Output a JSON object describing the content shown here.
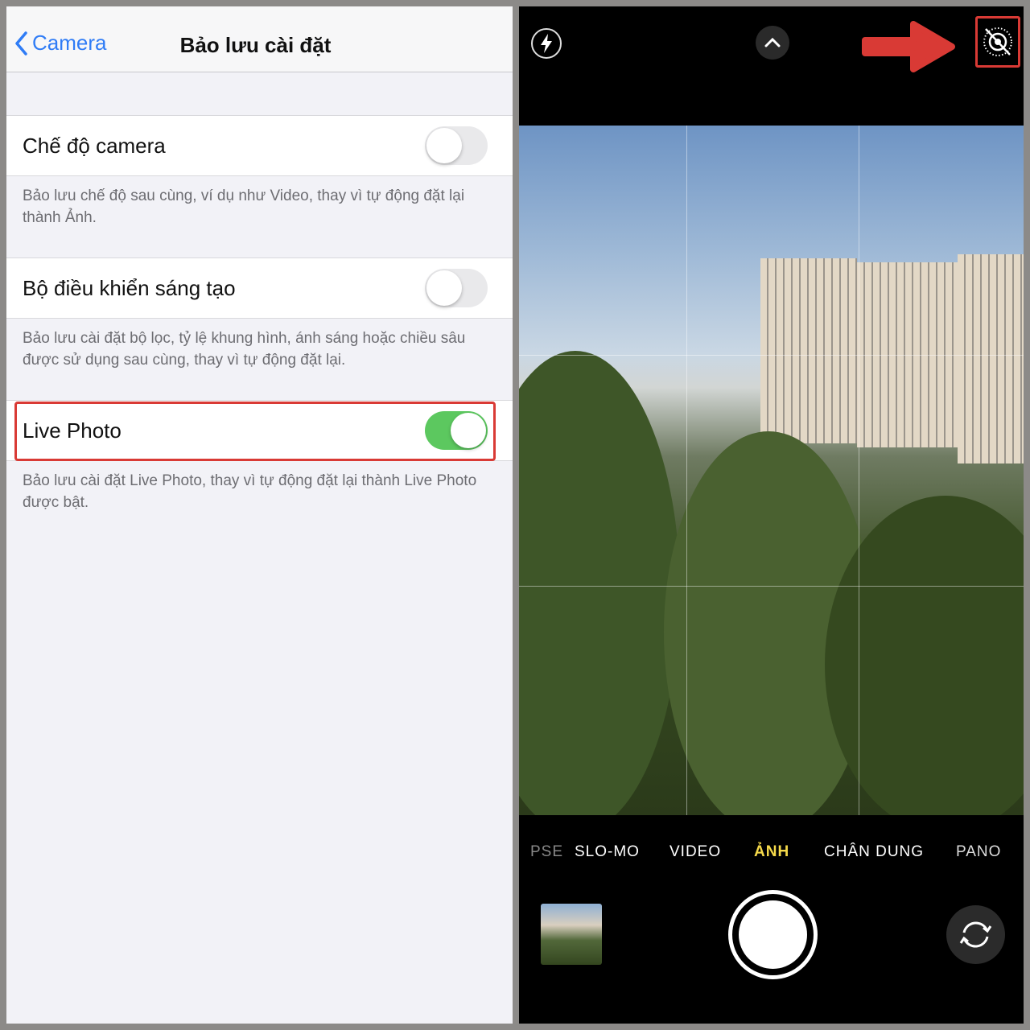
{
  "settings": {
    "back_label": "Camera",
    "title": "Bảo lưu cài đặt",
    "rows": [
      {
        "label": "Chế độ camera",
        "on": false,
        "desc": "Bảo lưu chế độ sau cùng, ví dụ như Video, thay vì tự động đặt lại thành Ảnh."
      },
      {
        "label": "Bộ điều khiển sáng tạo",
        "on": false,
        "desc": "Bảo lưu cài đặt bộ lọc, tỷ lệ khung hình, ánh sáng hoặc chiều sâu được sử dụng sau cùng, thay vì tự động đặt lại."
      },
      {
        "label": "Live Photo",
        "on": true,
        "desc": "Bảo lưu cài đặt Live Photo, thay vì tự động đặt lại thành Live Photo được bật."
      }
    ],
    "toggle_on_color": "#5cc85f",
    "accent": "#2f7cf6",
    "highlight_color": "#d93a35"
  },
  "camera": {
    "top_icons": [
      "flash-icon",
      "chevron-up-icon",
      "live-photo-off-icon"
    ],
    "modes": [
      "PSE",
      "SLO-MO",
      "VIDEO",
      "ẢNH",
      "CHÂN DUNG",
      "PANO"
    ],
    "active_mode": "ẢNH",
    "active_color": "#f5d94a",
    "annotation": "red-arrow-icon"
  }
}
